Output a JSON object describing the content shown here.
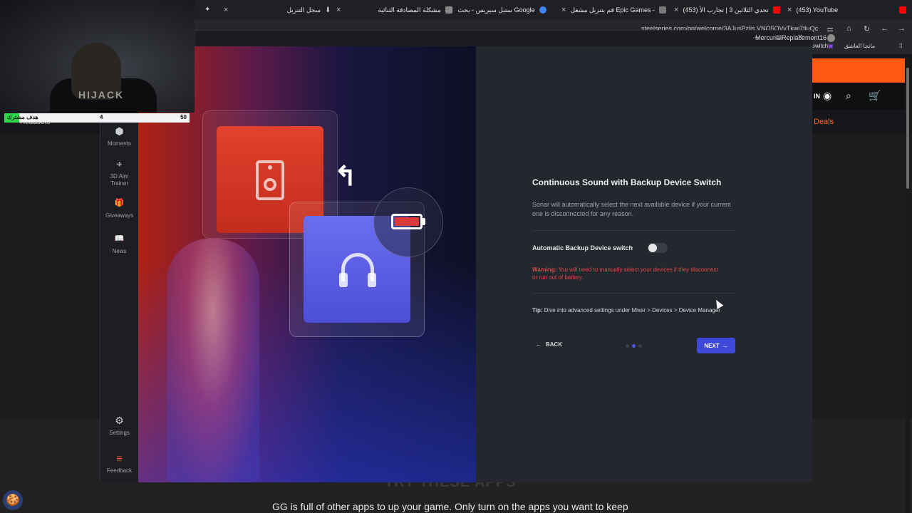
{
  "browser": {
    "tabs": [
      {
        "label": "(453) YouTube",
        "fav_color": "#ff0000"
      },
      {
        "label": "(453) تحدي الثلاثين 3 | تجارب الأ",
        "fav_color": "#ff0000"
      },
      {
        "label": "قم بتنزيل مشغل Epic Games - ",
        "fav_color": "#777777"
      },
      {
        "label": "ستيل سيريس - بحث Google",
        "fav_color": "#4285f4"
      },
      {
        "label": "مشكلة المصادقة الثنائية",
        "fav_color": "#888888"
      },
      {
        "label": "سجل التنزيل",
        "fav_color": "#cccccc"
      }
    ],
    "close_glyph": "×",
    "url": "steelseries.com/gg/welcome/3AJusPzlis.VNQ5QVyTkwi7tluQc",
    "bookmarks": [
      "switch",
      "مانجا العاشق"
    ]
  },
  "webcam": {
    "shirt_text": "HIJACK",
    "sub_goal": {
      "label": "هدف مشترك",
      "current": "4",
      "target": "50",
      "progress": 0.08
    }
  },
  "site": {
    "sign_in": "IN",
    "deals": "Deals",
    "behind_label": "Headsets",
    "heading": "TRY THESE APPS",
    "text": "GG is full of other apps to up your game. Only turn on the apps you want to keep",
    "brand_color": "#ff5a12"
  },
  "app": {
    "username": "MercurialReplacement16",
    "sidebar": [
      {
        "icon": "⬢",
        "label": "Moments"
      },
      {
        "icon": "⌖",
        "label": "3D Aim Trainer"
      },
      {
        "icon": "🎁",
        "label": "Giveaways"
      },
      {
        "icon": "📖",
        "label": "News"
      }
    ],
    "settings": {
      "icon": "⚙",
      "label": "Settings"
    },
    "feedback": {
      "icon": "≡",
      "label": "Feedback"
    },
    "panel": {
      "title": "Continuous Sound with Backup Device Switch",
      "description": "Sonar will automatically select the next available device if your current one is disconnected for any reason.",
      "toggle_label": "Automatic Backup Device switch",
      "toggle_on": false,
      "warning_prefix": "Warning:",
      "warning_text": " You will need to manually select your devices if they disconnect or run out of battery.",
      "tip_prefix": "Tip:",
      "tip_text": " Dive into advanced settings under Mixer > Devices > Device Manager",
      "back_label": "BACK",
      "next_label": "NEXT",
      "step_total": 3,
      "step_current": 2
    },
    "accent_color": "#3e49d9",
    "warning_color": "#e0464a"
  }
}
